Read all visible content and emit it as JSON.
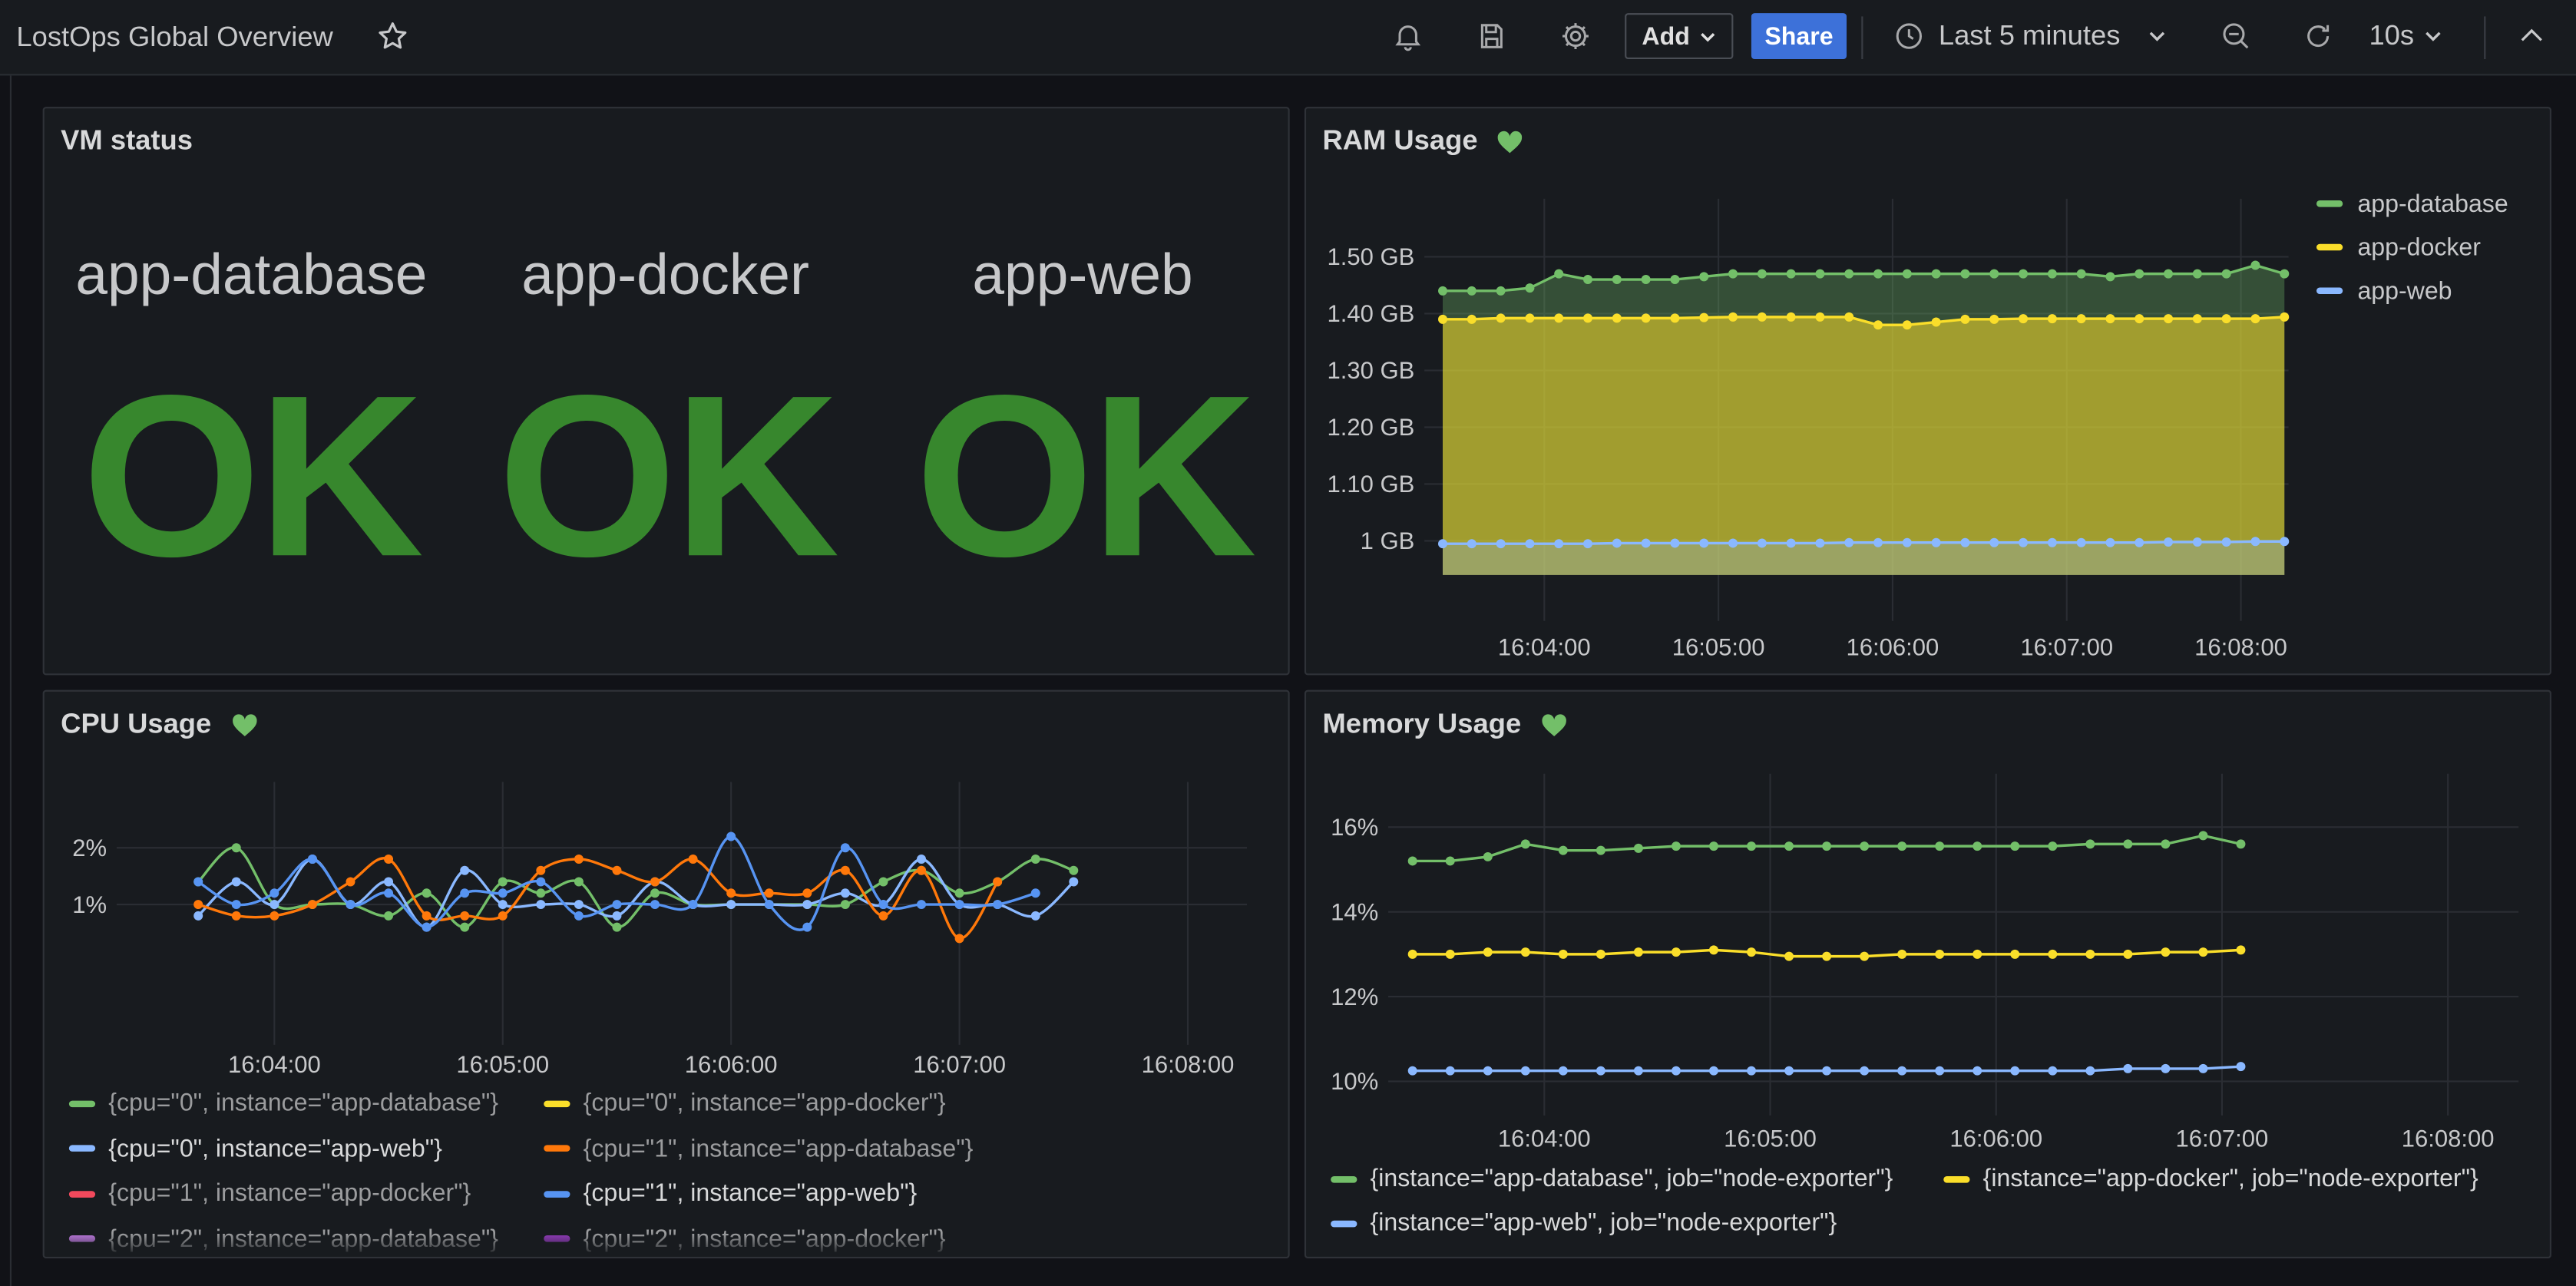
{
  "dashboard": {
    "title": "LostOps Global Overview"
  },
  "toolbar": {
    "add_label": "Add",
    "share_label": "Share",
    "time_range": "Last 5 minutes",
    "refresh_interval": "10s"
  },
  "icons": {
    "star": "star-icon",
    "alert": "bell-icon",
    "save": "save-icon",
    "settings": "gear-icon",
    "clock": "clock-icon",
    "zoom_out": "zoom-out-icon",
    "refresh": "refresh-icon",
    "collapse": "chevron-up-icon"
  },
  "colors": {
    "green": "#73bf69",
    "yellow": "#fade2a",
    "blue": "#8ab8ff",
    "orange": "#ff780a",
    "red": "#f2495c",
    "blue2": "#5794f2",
    "purple": "#b877d9",
    "ok": "#37872d",
    "share": "#3d71d9"
  },
  "vm_status": {
    "title": "VM status",
    "items": [
      {
        "name": "app-database",
        "status": "OK"
      },
      {
        "name": "app-docker",
        "status": "OK"
      },
      {
        "name": "app-web",
        "status": "OK"
      }
    ]
  },
  "ram_usage": {
    "title": "RAM Usage"
  },
  "cpu_usage": {
    "title": "CPU Usage"
  },
  "memory_usage": {
    "title": "Memory Usage"
  },
  "chart_data": [
    {
      "type": "area",
      "title": "RAM Usage",
      "x": [
        "16:03:25",
        "16:03:35",
        "16:03:45",
        "16:03:55",
        "16:04:05",
        "16:04:15",
        "16:04:25",
        "16:04:35",
        "16:04:45",
        "16:04:55",
        "16:05:05",
        "16:05:15",
        "16:05:25",
        "16:05:35",
        "16:05:45",
        "16:05:55",
        "16:06:05",
        "16:06:15",
        "16:06:25",
        "16:06:35",
        "16:06:45",
        "16:06:55",
        "16:07:05",
        "16:07:15",
        "16:07:25",
        "16:07:35",
        "16:07:45",
        "16:07:55",
        "16:08:05",
        "16:08:15"
      ],
      "x_ticks": [
        "16:04:00",
        "16:05:00",
        "16:06:00",
        "16:07:00",
        "16:08:00"
      ],
      "y_ticks": [
        "1.50 GB",
        "1.40 GB",
        "1.30 GB",
        "1.20 GB",
        "1.10 GB",
        "1 GB"
      ],
      "ylim": [
        0.94,
        1.55
      ],
      "legend_position": "right",
      "series": [
        {
          "name": "app-database",
          "color": "#73bf69",
          "values": [
            1.44,
            1.44,
            1.44,
            1.445,
            1.47,
            1.46,
            1.46,
            1.46,
            1.46,
            1.465,
            1.47,
            1.47,
            1.47,
            1.47,
            1.47,
            1.47,
            1.47,
            1.47,
            1.47,
            1.47,
            1.47,
            1.47,
            1.47,
            1.465,
            1.47,
            1.47,
            1.47,
            1.47,
            1.485,
            1.47
          ]
        },
        {
          "name": "app-docker",
          "color": "#fade2a",
          "values": [
            1.39,
            1.39,
            1.392,
            1.392,
            1.392,
            1.392,
            1.392,
            1.392,
            1.392,
            1.393,
            1.394,
            1.394,
            1.394,
            1.394,
            1.394,
            1.38,
            1.38,
            1.385,
            1.39,
            1.39,
            1.391,
            1.391,
            1.391,
            1.391,
            1.391,
            1.391,
            1.391,
            1.391,
            1.391,
            1.394
          ]
        },
        {
          "name": "app-web",
          "color": "#8ab8ff",
          "values": [
            0.995,
            0.995,
            0.995,
            0.995,
            0.995,
            0.995,
            0.996,
            0.996,
            0.996,
            0.996,
            0.996,
            0.996,
            0.996,
            0.996,
            0.997,
            0.997,
            0.997,
            0.997,
            0.997,
            0.997,
            0.997,
            0.997,
            0.997,
            0.997,
            0.997,
            0.998,
            0.998,
            0.998,
            0.999,
            0.999
          ]
        }
      ]
    },
    {
      "type": "line",
      "title": "CPU Usage",
      "x": [
        "16:03:40",
        "16:03:50",
        "16:04:00",
        "16:04:10",
        "16:04:20",
        "16:04:30",
        "16:04:40",
        "16:04:50",
        "16:05:00",
        "16:05:10",
        "16:05:20",
        "16:05:30",
        "16:05:40",
        "16:05:50",
        "16:06:00",
        "16:06:10",
        "16:06:20",
        "16:06:30",
        "16:06:40",
        "16:06:50",
        "16:07:00",
        "16:07:10",
        "16:07:20",
        "16:07:30",
        "16:07:40",
        "16:07:50",
        "16:08:00",
        "16:08:10",
        "16:08:20"
      ],
      "x_ticks": [
        "16:04:00",
        "16:05:00",
        "16:06:00",
        "16:07:00",
        "16:08:00"
      ],
      "y_ticks": [
        "2%",
        "1%"
      ],
      "ylim": [
        0.35,
        2.35
      ],
      "series": [
        {
          "name": "{cpu=\"0\", instance=\"app-database\"}",
          "color": "#73bf69",
          "values": [
            1.4,
            2.0,
            1.0,
            1.0,
            1.0,
            0.8,
            1.2,
            0.6,
            1.4,
            1.2,
            1.4,
            0.6,
            1.2,
            1.0,
            1.0,
            1.0,
            1.0,
            1.0,
            1.4,
            1.6,
            1.2,
            1.4,
            1.8,
            1.6
          ]
        },
        {
          "name": "{cpu=\"0\", instance=\"app-docker\"}",
          "color": "#fade2a",
          "values": []
        },
        {
          "name": "{cpu=\"0\", instance=\"app-web\"}",
          "color": "#8ab8ff",
          "values": [
            0.8,
            1.4,
            1.0,
            1.8,
            1.0,
            1.4,
            0.6,
            1.6,
            1.0,
            1.0,
            1.0,
            0.8,
            1.4,
            1.0,
            1.0,
            1.0,
            1.0,
            1.2,
            1.0,
            1.8,
            1.0,
            1.0,
            0.8,
            1.4
          ]
        },
        {
          "name": "{cpu=\"1\", instance=\"app-database\"}",
          "color": "#ff780a",
          "values": [
            1.0,
            0.8,
            0.8,
            1.0,
            1.4,
            1.8,
            0.8,
            0.8,
            0.8,
            1.6,
            1.8,
            1.6,
            1.4,
            1.8,
            1.2,
            1.2,
            1.2,
            1.6,
            0.8,
            1.6,
            0.4,
            1.4
          ]
        },
        {
          "name": "{cpu=\"1\", instance=\"app-docker\"}",
          "color": "#f2495c",
          "values": []
        },
        {
          "name": "{cpu=\"1\", instance=\"app-web\"}",
          "color": "#5794f2",
          "values": [
            1.4,
            1.0,
            1.2,
            1.8,
            1.0,
            1.2,
            0.6,
            1.2,
            1.2,
            1.4,
            0.8,
            1.0,
            1.0,
            1.0,
            2.2,
            1.0,
            0.6,
            2.0,
            1.0,
            1.0,
            1.0,
            1.0,
            1.2
          ]
        },
        {
          "name": "{cpu=\"2\", instance=\"app-database\"}",
          "color": "#b877d9",
          "values": []
        },
        {
          "name": "{cpu=\"2\", instance=\"app-docker\"}",
          "color": "#8f3bb8",
          "values": []
        }
      ]
    },
    {
      "type": "line",
      "title": "Memory Usage",
      "x": [
        "16:03:25",
        "16:03:35",
        "16:03:45",
        "16:03:55",
        "16:04:05",
        "16:04:15",
        "16:04:25",
        "16:04:35",
        "16:04:45",
        "16:04:55",
        "16:05:05",
        "16:05:15",
        "16:05:25",
        "16:05:35",
        "16:05:45",
        "16:05:55",
        "16:06:05",
        "16:06:15",
        "16:06:25",
        "16:06:35",
        "16:06:45",
        "16:06:55",
        "16:07:05",
        "16:07:15",
        "16:07:25",
        "16:07:35",
        "16:07:45",
        "16:07:55",
        "16:08:05",
        "16:08:15"
      ],
      "x_ticks": [
        "16:04:00",
        "16:05:00",
        "16:06:00",
        "16:07:00",
        "16:08:00"
      ],
      "y_ticks": [
        "16%",
        "14%",
        "12%",
        "10%"
      ],
      "ylim": [
        9.7,
        16.6
      ],
      "series": [
        {
          "name": "{instance=\"app-database\", job=\"node-exporter\"}",
          "color": "#73bf69",
          "values": [
            15.2,
            15.2,
            15.3,
            15.6,
            15.45,
            15.45,
            15.5,
            15.55,
            15.55,
            15.55,
            15.55,
            15.55,
            15.55,
            15.55,
            15.55,
            15.55,
            15.55,
            15.55,
            15.6,
            15.6,
            15.6,
            15.8,
            15.6
          ]
        },
        {
          "name": "{instance=\"app-docker\", job=\"node-exporter\"}",
          "color": "#fade2a",
          "values": [
            13.0,
            13.0,
            13.05,
            13.05,
            13.0,
            13.0,
            13.05,
            13.05,
            13.1,
            13.05,
            12.95,
            12.95,
            12.95,
            13.0,
            13.0,
            13.0,
            13.0,
            13.0,
            13.0,
            13.0,
            13.05,
            13.05,
            13.1
          ]
        },
        {
          "name": "{instance=\"app-web\", job=\"node-exporter\"}",
          "color": "#8ab8ff",
          "values": [
            10.25,
            10.25,
            10.25,
            10.25,
            10.25,
            10.25,
            10.25,
            10.25,
            10.25,
            10.25,
            10.25,
            10.25,
            10.25,
            10.25,
            10.25,
            10.25,
            10.25,
            10.25,
            10.25,
            10.3,
            10.3,
            10.3,
            10.35
          ]
        }
      ]
    }
  ]
}
